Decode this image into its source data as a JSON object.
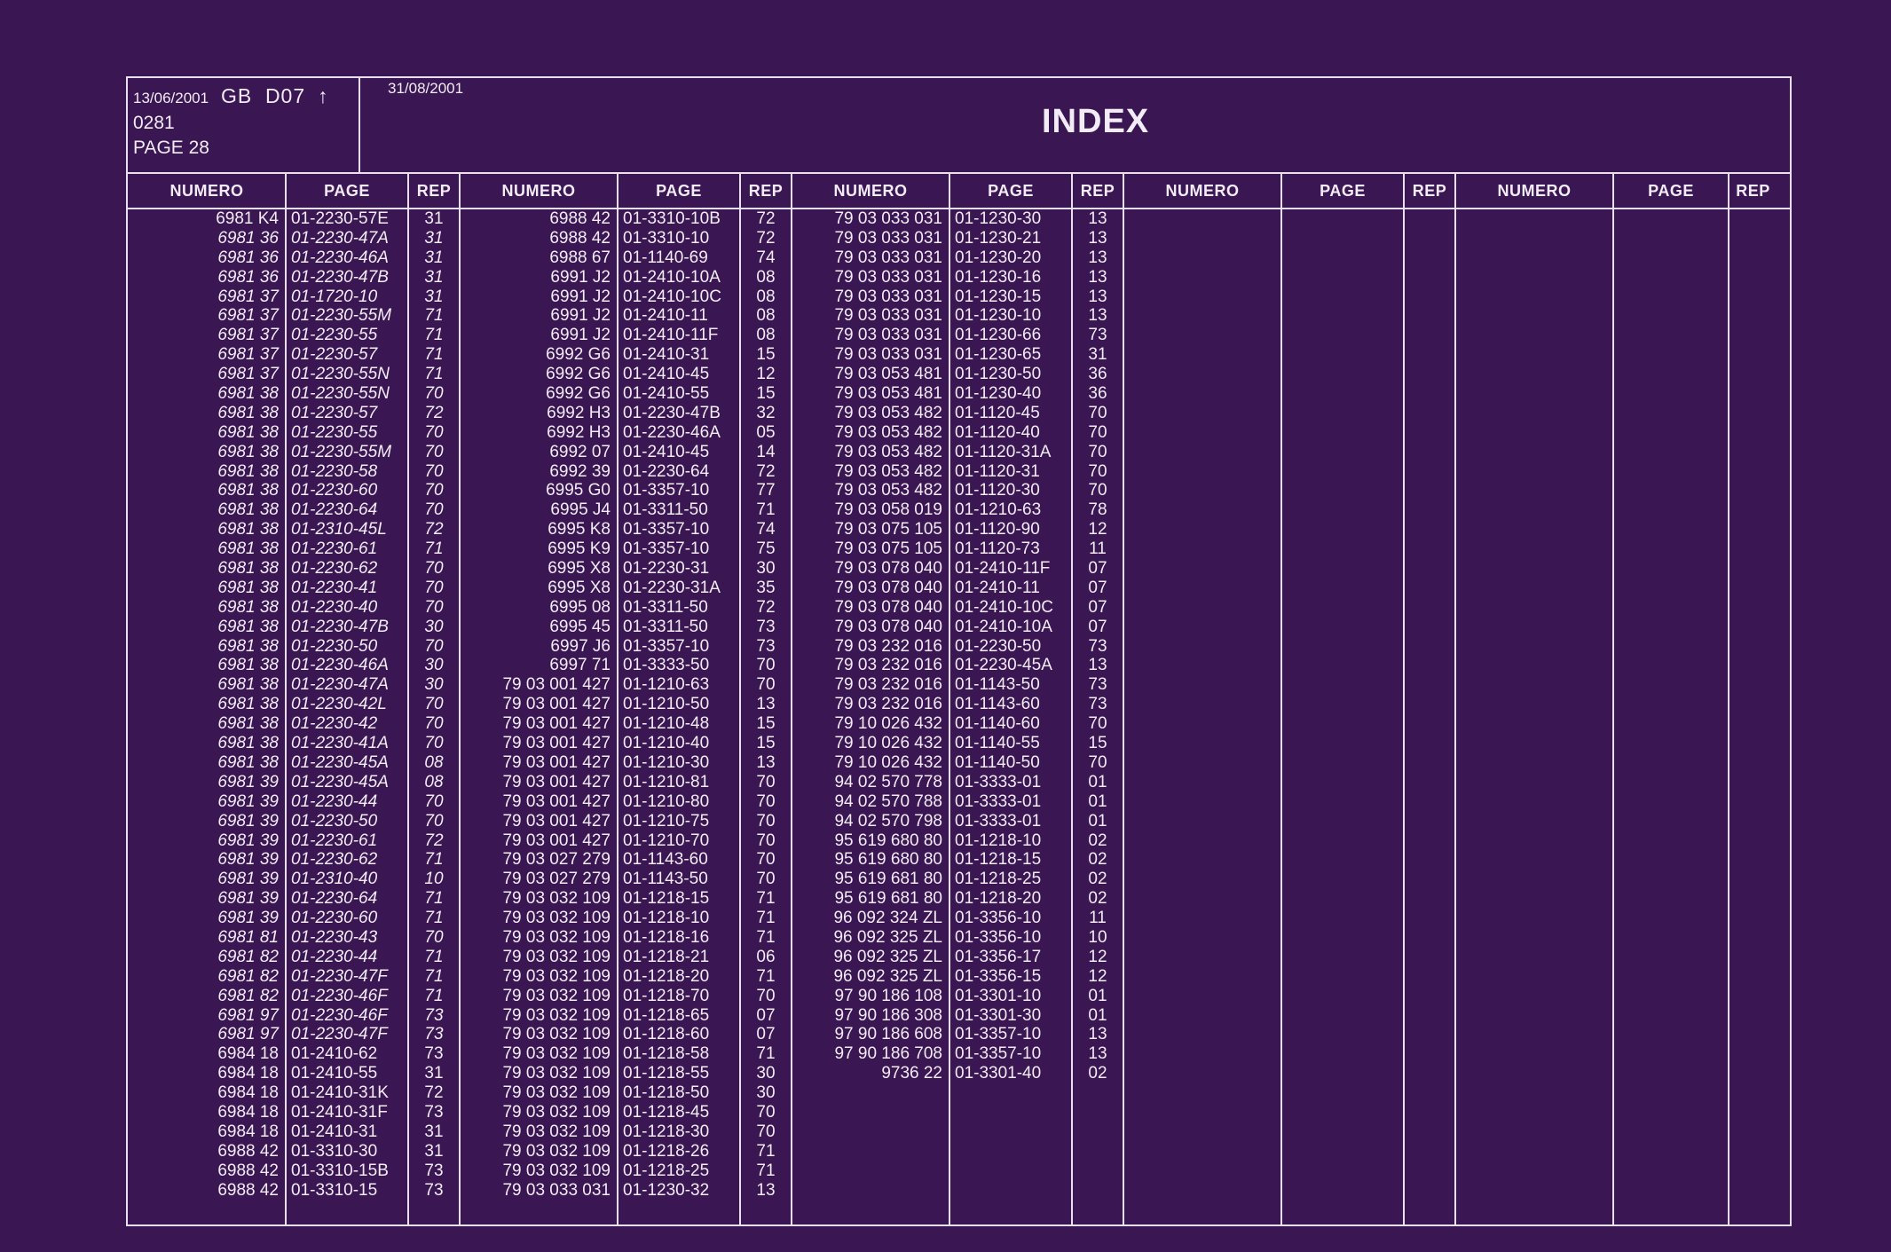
{
  "header": {
    "date1": "13/06/2001",
    "code": "GB  D07",
    "arrow": "↑",
    "number": "0281",
    "page_label": "PAGE 28",
    "date2": "31/08/2001",
    "title": "INDEX"
  },
  "columns": [
    "NUMERO",
    "PAGE",
    "REP",
    "NUMERO",
    "PAGE",
    "REP",
    "NUMERO",
    "PAGE",
    "REP",
    "NUMERO",
    "PAGE",
    "REP",
    "NUMERO",
    "PAGE",
    "REP"
  ],
  "blocks": [
    {
      "numero": [
        "6981 K4",
        "6981 36",
        "6981 36",
        "6981 36",
        "6981 37",
        "6981 37",
        "6981 37",
        "6981 37",
        "6981 37",
        "6981 38",
        "6981 38",
        "6981 38",
        "6981 38",
        "6981 38",
        "6981 38",
        "6981 38",
        "6981 38",
        "6981 38",
        "6981 38",
        "6981 38",
        "6981 38",
        "6981 38",
        "6981 38",
        "6981 38",
        "6981 38",
        "6981 38",
        "6981 38",
        "6981 38",
        "6981 38",
        "6981 39",
        "6981 39",
        "6981 39",
        "6981 39",
        "6981 39",
        "6981 39",
        "6981 39",
        "6981 39",
        "6981 81",
        "6981 82",
        "6981 82",
        "6981 82",
        "6981 97",
        "6981 97",
        "6984 18",
        "6984 18",
        "6984 18",
        "6984 18",
        "6984 18",
        "6988 42",
        "6988 42",
        "6988 42"
      ],
      "page": [
        "01-2230-57E",
        "01-2230-47A",
        "01-2230-46A",
        "01-2230-47B",
        "01-1720-10",
        "01-2230-55M",
        "01-2230-55",
        "01-2230-57",
        "01-2230-55N",
        "01-2230-55N",
        "01-2230-57",
        "01-2230-55",
        "01-2230-55M",
        "01-2230-58",
        "01-2230-60",
        "01-2230-64",
        "01-2310-45L",
        "01-2230-61",
        "01-2230-62",
        "01-2230-41",
        "01-2230-40",
        "01-2230-47B",
        "01-2230-50",
        "01-2230-46A",
        "01-2230-47A",
        "01-2230-42L",
        "01-2230-42",
        "01-2230-41A",
        "01-2230-45A",
        "01-2230-45A",
        "01-2230-44",
        "01-2230-50",
        "01-2230-61",
        "01-2230-62",
        "01-2310-40",
        "01-2230-64",
        "01-2230-60",
        "01-2230-43",
        "01-2230-44",
        "01-2230-47F",
        "01-2230-46F",
        "01-2230-46F",
        "01-2230-47F",
        "01-2410-62",
        "01-2410-55",
        "01-2410-31K",
        "01-2410-31F",
        "01-2410-31",
        "01-3310-30",
        "01-3310-15B",
        "01-3310-15"
      ],
      "rep": [
        "31",
        "31",
        "31",
        "31",
        "31",
        "71",
        "71",
        "71",
        "71",
        "70",
        "72",
        "70",
        "70",
        "70",
        "70",
        "70",
        "72",
        "71",
        "70",
        "70",
        "70",
        "30",
        "70",
        "30",
        "30",
        "70",
        "70",
        "70",
        "08",
        "08",
        "70",
        "70",
        "72",
        "71",
        "10",
        "71",
        "71",
        "70",
        "71",
        "71",
        "71",
        "73",
        "73",
        "73",
        "31",
        "72",
        "73",
        "31",
        "31",
        "73",
        "73"
      ]
    },
    {
      "numero": [
        "6988 42",
        "6988 42",
        "6988 67",
        "6991 J2",
        "6991 J2",
        "6991 J2",
        "6991 J2",
        "6992 G6",
        "6992 G6",
        "6992 G6",
        "6992 H3",
        "6992 H3",
        "6992 07",
        "6992 39",
        "6995 G0",
        "6995 J4",
        "6995 K8",
        "6995 K9",
        "6995 X8",
        "6995 X8",
        "6995 08",
        "6995 45",
        "6997 J6",
        "6997 71",
        "79 03 001 427",
        "79 03 001 427",
        "79 03 001 427",
        "79 03 001 427",
        "79 03 001 427",
        "79 03 001 427",
        "79 03 001 427",
        "79 03 001 427",
        "79 03 001 427",
        "79 03 027 279",
        "79 03 027 279",
        "79 03 032 109",
        "79 03 032 109",
        "79 03 032 109",
        "79 03 032 109",
        "79 03 032 109",
        "79 03 032 109",
        "79 03 032 109",
        "79 03 032 109",
        "79 03 032 109",
        "79 03 032 109",
        "79 03 032 109",
        "79 03 032 109",
        "79 03 032 109",
        "79 03 032 109",
        "79 03 032 109",
        "79 03 033 031"
      ],
      "page": [
        "01-3310-10B",
        "01-3310-10",
        "01-1140-69",
        "01-2410-10A",
        "01-2410-10C",
        "01-2410-11",
        "01-2410-11F",
        "01-2410-31",
        "01-2410-45",
        "01-2410-55",
        "01-2230-47B",
        "01-2230-46A",
        "01-2410-45",
        "01-2230-64",
        "01-3357-10",
        "01-3311-50",
        "01-3357-10",
        "01-3357-10",
        "01-2230-31",
        "01-2230-31A",
        "01-3311-50",
        "01-3311-50",
        "01-3357-10",
        "01-3333-50",
        "01-1210-63",
        "01-1210-50",
        "01-1210-48",
        "01-1210-40",
        "01-1210-30",
        "01-1210-81",
        "01-1210-80",
        "01-1210-75",
        "01-1210-70",
        "01-1143-60",
        "01-1143-50",
        "01-1218-15",
        "01-1218-10",
        "01-1218-16",
        "01-1218-21",
        "01-1218-20",
        "01-1218-70",
        "01-1218-65",
        "01-1218-60",
        "01-1218-58",
        "01-1218-55",
        "01-1218-50",
        "01-1218-45",
        "01-1218-30",
        "01-1218-26",
        "01-1218-25",
        "01-1230-32"
      ],
      "rep": [
        "72",
        "72",
        "74",
        "08",
        "08",
        "08",
        "08",
        "15",
        "12",
        "15",
        "32",
        "05",
        "14",
        "72",
        "77",
        "71",
        "74",
        "75",
        "30",
        "35",
        "72",
        "73",
        "73",
        "70",
        "70",
        "13",
        "15",
        "15",
        "13",
        "70",
        "70",
        "70",
        "70",
        "70",
        "70",
        "71",
        "71",
        "71",
        "06",
        "71",
        "70",
        "07",
        "07",
        "71",
        "30",
        "30",
        "70",
        "70",
        "71",
        "71",
        "13"
      ]
    },
    {
      "numero": [
        "79 03 033 031",
        "79 03 033 031",
        "79 03 033 031",
        "79 03 033 031",
        "79 03 033 031",
        "79 03 033 031",
        "79 03 033 031",
        "79 03 033 031",
        "79 03 053 481",
        "79 03 053 481",
        "79 03 053 482",
        "79 03 053 482",
        "79 03 053 482",
        "79 03 053 482",
        "79 03 053 482",
        "79 03 058 019",
        "79 03 075 105",
        "79 03 075 105",
        "79 03 078 040",
        "79 03 078 040",
        "79 03 078 040",
        "79 03 078 040",
        "79 03 232 016",
        "79 03 232 016",
        "79 03 232 016",
        "79 03 232 016",
        "79 10 026 432",
        "79 10 026 432",
        "79 10 026 432",
        "94 02 570 778",
        "94 02 570 788",
        "94 02 570 798",
        "95 619 680 80",
        "95 619 680 80",
        "95 619 681 80",
        "95 619 681 80",
        "96 092 324 ZL",
        "96 092 325 ZL",
        "96 092 325 ZL",
        "96 092 325 ZL",
        "97 90 186 108",
        "97 90 186 308",
        "97 90 186 608",
        "97 90 186 708",
        "9736 22"
      ],
      "page": [
        "01-1230-30",
        "01-1230-21",
        "01-1230-20",
        "01-1230-16",
        "01-1230-15",
        "01-1230-10",
        "01-1230-66",
        "01-1230-65",
        "01-1230-50",
        "01-1230-40",
        "01-1120-45",
        "01-1120-40",
        "01-1120-31A",
        "01-1120-31",
        "01-1120-30",
        "01-1210-63",
        "01-1120-90",
        "01-1120-73",
        "01-2410-11F",
        "01-2410-11",
        "01-2410-10C",
        "01-2410-10A",
        "01-2230-50",
        "01-2230-45A",
        "01-1143-50",
        "01-1143-60",
        "01-1140-60",
        "01-1140-55",
        "01-1140-50",
        "01-3333-01",
        "01-3333-01",
        "01-3333-01",
        "01-1218-10",
        "01-1218-15",
        "01-1218-25",
        "01-1218-20",
        "01-3356-10",
        "01-3356-10",
        "01-3356-17",
        "01-3356-15",
        "01-3301-10",
        "01-3301-30",
        "01-3357-10",
        "01-3357-10",
        "01-3301-40"
      ],
      "rep": [
        "13",
        "13",
        "13",
        "13",
        "13",
        "13",
        "73",
        "31",
        "36",
        "36",
        "70",
        "70",
        "70",
        "70",
        "70",
        "78",
        "12",
        "11",
        "07",
        "07",
        "07",
        "07",
        "73",
        "13",
        "73",
        "73",
        "70",
        "15",
        "70",
        "01",
        "01",
        "01",
        "02",
        "02",
        "02",
        "02",
        "11",
        "10",
        "12",
        "12",
        "01",
        "01",
        "13",
        "13",
        "02"
      ]
    },
    {
      "numero": [],
      "page": [],
      "rep": []
    },
    {
      "numero": [],
      "page": [],
      "rep": []
    }
  ],
  "colors": {
    "background": "#3a1653",
    "ink": "#f2ecf6",
    "rule": "#e8e0ee"
  }
}
